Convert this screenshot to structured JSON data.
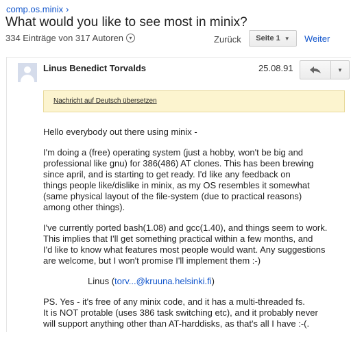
{
  "breadcrumb": {
    "group": "comp.os.minix",
    "chevron_icon": "chevron-right-icon"
  },
  "thread": {
    "title": "What would you like to see most in minix?",
    "meta": "334 Einträge von 317 Autoren",
    "meta_icon": "chevron-down-circle-icon"
  },
  "pager": {
    "back_label": "Zurück",
    "page_label": "Seite 1",
    "next_label": "Weiter"
  },
  "post": {
    "author": "Linus Benedict Torvalds",
    "date": "25.08.91",
    "translate_label": "Nachricht auf Deutsch übersetzen",
    "greeting": "Hello everybody out there using minix -",
    "para1": "I'm doing a (free) operating system (just a hobby, won't be big and\nprofessional like gnu) for 386(486) AT clones.  This has been brewing\nsince april, and is starting to get ready.  I'd like any feedback on\nthings people like/dislike in minix, as my OS resembles it somewhat\n(same physical layout of the file-system (due to practical reasons)\namong other things).",
    "para2": "I've currently ported bash(1.08) and gcc(1.40), and things seem to work.\nThis implies that I'll get something practical within a few months, and\nI'd like to know what features most people would want.  Any suggestions\nare welcome, but I won't promise I'll implement them :-)",
    "sig_name": "Linus",
    "sig_open": "(",
    "sig_email": "torv...@kruuna.helsinki.fi",
    "sig_close": ")",
    "ps": "PS.  Yes - it's free of any minix code, and it has a multi-threaded fs.\nIt is NOT protable (uses 386 task switching etc), and it probably never\nwill support anything other than AT-harddisks, as that's all I have :-(."
  },
  "colors": {
    "link": "#1155cc",
    "translate_bg": "#fcf4cf",
    "avatar_bg": "#d5dceb"
  }
}
